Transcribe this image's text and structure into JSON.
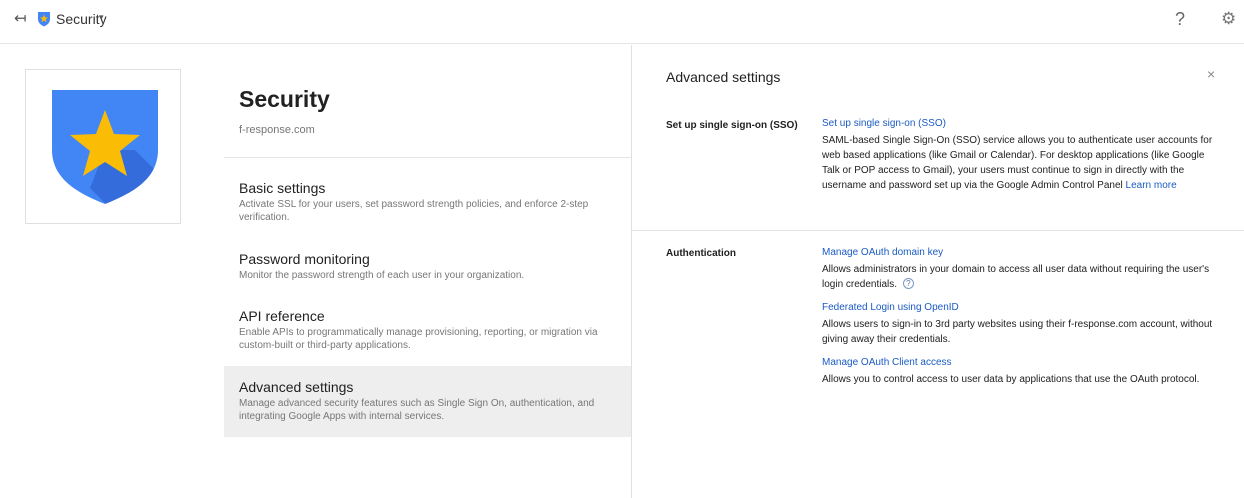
{
  "topbar": {
    "back_glyph": "↤",
    "app_name": "Security",
    "caret_glyph": "▾",
    "help_glyph": "?",
    "gear_glyph": "⚙"
  },
  "page": {
    "title": "Security",
    "domain": "f-response.com"
  },
  "nav": [
    {
      "label": "Basic settings",
      "desc": "Activate SSL for your users, set password strength policies, and enforce 2-step verification."
    },
    {
      "label": "Password monitoring",
      "desc": "Monitor the password strength of each user in your organization."
    },
    {
      "label": "API reference",
      "desc": "Enable APIs to programmatically manage provisioning, reporting, or migration via custom-built or third-party applications."
    },
    {
      "label": "Advanced settings",
      "desc": "Manage advanced security features such as Single Sign On, authentication, and integrating Google Apps with internal services."
    }
  ],
  "panel": {
    "title": "Advanced settings",
    "close_glyph": "×",
    "sso": {
      "label": "Set up single sign-on (SSO)",
      "link": "Set up single sign-on (SSO)",
      "desc": "SAML-based Single Sign-On (SSO) service allows you to authenticate user accounts for web based applications (like Gmail or Calendar). For desktop applications (like Google Talk or POP access to Gmail), your users must continue to sign in directly with the username and password set up via the Google Admin Control Panel",
      "learn_more": "Learn more"
    },
    "auth": {
      "label": "Authentication",
      "items": [
        {
          "link": "Manage OAuth domain key",
          "desc": "Allows administrators in your domain to access all user data without requiring the user's login credentials.",
          "help": "?"
        },
        {
          "link": "Federated Login using OpenID",
          "desc": "Allows users to sign-in to 3rd party websites using their f-response.com account, without giving away their credentials."
        },
        {
          "link": "Manage OAuth Client access",
          "desc": "Allows you to control access to user data by applications that use the OAuth protocol."
        }
      ]
    }
  },
  "colors": {
    "shield_blue": "#4285f4",
    "shield_shadow": "#3367d6",
    "star_yellow": "#fbbc05",
    "link_blue": "#1a5bc4",
    "active_bg": "#eeeeee"
  }
}
